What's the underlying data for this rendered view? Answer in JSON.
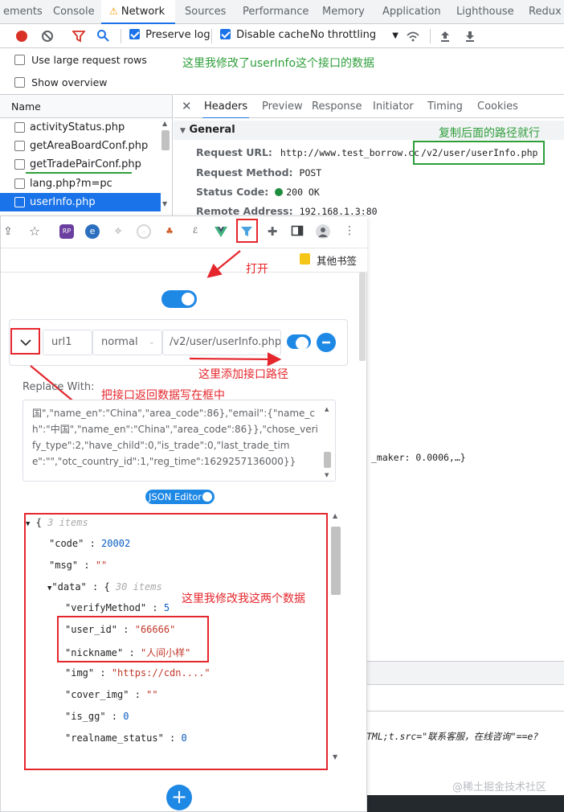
{
  "devtools": {
    "tabs": [
      "ements",
      "Console",
      "Network",
      "Sources",
      "Performance",
      "Memory",
      "Application",
      "Lighthouse",
      "Redux"
    ],
    "active_tab": "Network",
    "toolbar": {
      "preserve_log": "Preserve log",
      "disable_cache": "Disable cache",
      "throttling": "No throttling"
    },
    "settings": {
      "large_rows": "Use large request rows",
      "overview": "Show overview"
    },
    "request_list": {
      "header": "Name",
      "items": [
        "activityStatus.php",
        "getAreaBoardConf.php",
        "getTradePairConf.php",
        "lang.php?m=pc",
        "userInfo.php"
      ],
      "selected": "userInfo.php"
    },
    "detail_tabs": [
      "Headers",
      "Preview",
      "Response",
      "Initiator",
      "Timing",
      "Cookies"
    ],
    "active_detail_tab": "Headers",
    "general": {
      "title": "General",
      "request_url_label": "Request URL:",
      "request_url_value_prefix": "http://www.test_borrow.cc",
      "request_url_value_path": "/v2/user/userInfo.php",
      "method_label": "Request Method:",
      "method_value": "POST",
      "status_label": "Status Code:",
      "status_value": "200 OK",
      "remote_label": "Remote Address:",
      "remote_value": "192.168.1.3:80"
    },
    "background_text": {
      "maker": "_maker: 0.0006,…}",
      "bottom": "TML;t.src=\"联系客服，在线咨询\"==e?"
    }
  },
  "extension": {
    "bookmark": "其他书签",
    "rule": {
      "group": "url1",
      "mode": "normal",
      "path": "/v2/user/userInfo.php"
    },
    "replace_label": "Replace With:",
    "replace_text": "国\",\"name_en\":\"China\",\"area_code\":86},\"email\":{\"name_ch\":\"中国\",\"name_en\":\"China\",\"area_code\":86}},\"chose_verify_type\":2,\"have_child\":0,\"is_trade\":0,\"last_trade_time\":\"\",\"otc_country_id\":1,\"reg_time\":1629257136000}}",
    "json_editor_label": "JSON Editor",
    "json": {
      "root_meta": "3 items",
      "code_key": "\"code\"",
      "code_val": "20002",
      "msg_key": "\"msg\"",
      "msg_val": "\"\"",
      "data_key": "\"data\"",
      "data_meta": "30 items",
      "verify_key": "\"verifyMethod\"",
      "verify_val": "5",
      "userid_key": "\"user_id\"",
      "userid_val": "\"66666\"",
      "nickname_key": "\"nickname\"",
      "nickname_val": "\"人间小样\"",
      "img_key": "\"img\"",
      "img_val": "\"https://cdn....\"",
      "cover_key": "\"cover_img\"",
      "cover_val": "\"\"",
      "isgg_key": "\"is_gg\"",
      "isgg_val": "0",
      "realname_key": "\"realname_status\"",
      "realname_val": "0"
    }
  },
  "annotations": {
    "modified_api": "这里我修改了userInfo这个接口的数据",
    "copy_path": "复制后面的路径就行",
    "open": "打开",
    "add_path": "这里添加接口路径",
    "write_data": "把接口返回数据写在框中",
    "modified_two": "这里我修改我这两个数据"
  },
  "watermark": "@稀土掘金技术社区",
  "colors": {
    "accent": "#1a73e8",
    "annot_red": "#e5262c",
    "annot_green": "#2e9e3a",
    "toggle": "#1e88e5"
  }
}
